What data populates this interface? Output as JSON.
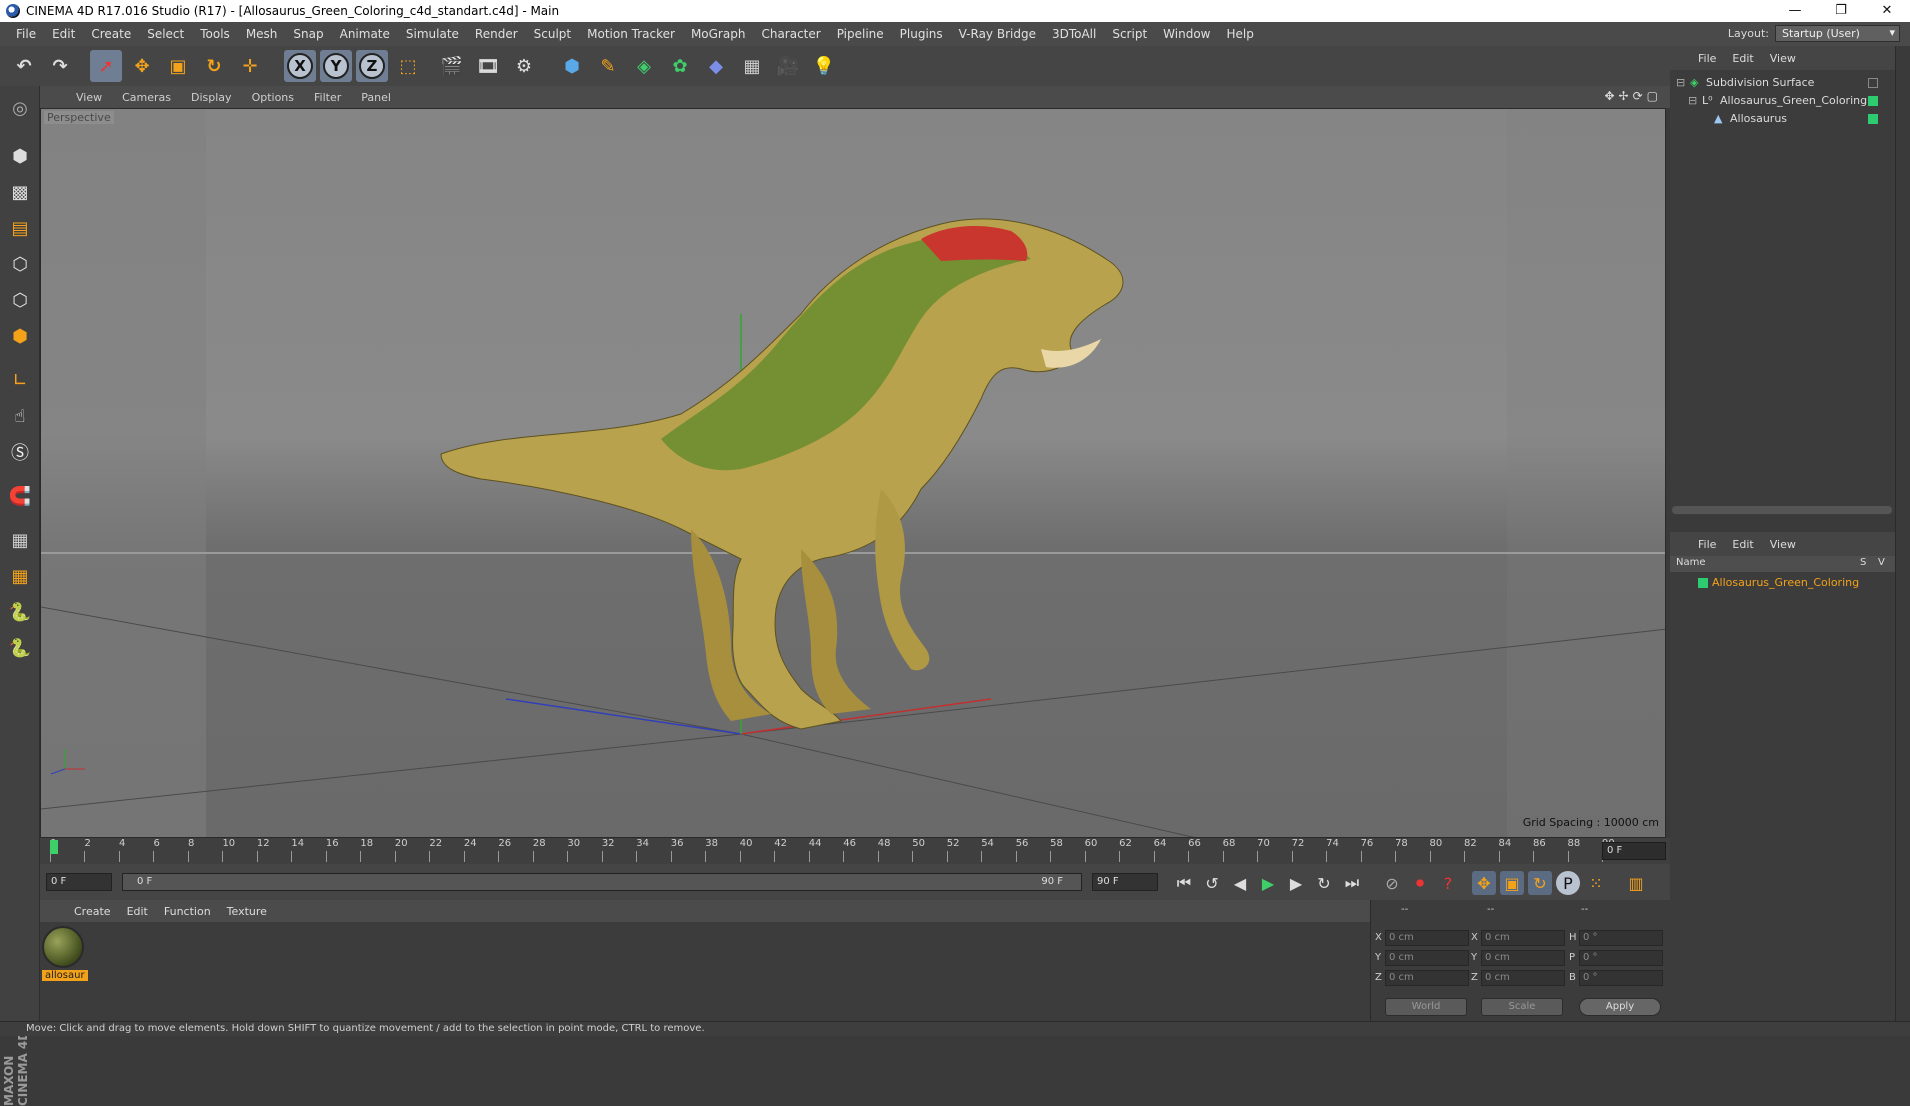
{
  "window": {
    "title": "CINEMA 4D R17.016 Studio (R17) - [Allosaurus_Green_Coloring_c4d_standart.c4d] - Main",
    "controls": [
      "—",
      "❐",
      "✕"
    ]
  },
  "menubar": {
    "items": [
      "File",
      "Edit",
      "Create",
      "Select",
      "Tools",
      "Mesh",
      "Snap",
      "Animate",
      "Simulate",
      "Render",
      "Sculpt",
      "Motion Tracker",
      "MoGraph",
      "Character",
      "Pipeline",
      "Plugins",
      "V-Ray Bridge",
      "3DToAll",
      "Script",
      "Window",
      "Help"
    ],
    "layout_label": "Layout:",
    "layout_value": "Startup (User)"
  },
  "toolbar": {
    "axis_x": "X",
    "axis_y": "Y",
    "axis_z": "Z"
  },
  "viewport": {
    "menu": [
      "View",
      "Cameras",
      "Display",
      "Options",
      "Filter",
      "Panel"
    ],
    "label": "Perspective",
    "grid_spacing": "Grid Spacing : 10000 cm"
  },
  "timeline": {
    "ticks": [
      "0",
      "2",
      "4",
      "6",
      "8",
      "10",
      "12",
      "14",
      "16",
      "18",
      "20",
      "22",
      "24",
      "26",
      "28",
      "30",
      "32",
      "34",
      "36",
      "38",
      "40",
      "42",
      "44",
      "46",
      "48",
      "50",
      "52",
      "54",
      "56",
      "58",
      "60",
      "62",
      "64",
      "66",
      "68",
      "70",
      "72",
      "74",
      "76",
      "78",
      "80",
      "82",
      "84",
      "86",
      "88",
      "90"
    ],
    "current_frame": "0 F"
  },
  "transport": {
    "start": "0 F",
    "range_start": "0 F",
    "range_end": "90 F",
    "end": "90 F"
  },
  "material_manager": {
    "menu": [
      "Create",
      "Edit",
      "Function",
      "Texture"
    ],
    "material_name": "allosaur"
  },
  "coordinates": {
    "header": [
      "--",
      "--",
      "--"
    ],
    "rows": [
      {
        "axis": "X",
        "pos": "0 cm",
        "axis2": "X",
        "size": "0 cm",
        "rot_label": "H",
        "rot": "0 °"
      },
      {
        "axis": "Y",
        "pos": "0 cm",
        "axis2": "Y",
        "size": "0 cm",
        "rot_label": "P",
        "rot": "0 °"
      },
      {
        "axis": "Z",
        "pos": "0 cm",
        "axis2": "Z",
        "size": "0 cm",
        "rot_label": "B",
        "rot": "0 °"
      }
    ],
    "mode1": "World",
    "mode2": "Scale",
    "apply": "Apply"
  },
  "object_manager": {
    "menu": [
      "File",
      "Edit",
      "View"
    ],
    "objects": [
      {
        "name": "Subdivision Surface",
        "color": "#2ecc71"
      },
      {
        "name": "Allosaurus_Green_Coloring",
        "color": "#2ecc71"
      },
      {
        "name": "Allosaurus",
        "color": "#2ecc71"
      }
    ]
  },
  "attribute_manager": {
    "menu": [
      "File",
      "Edit",
      "View"
    ],
    "col_name": "Name",
    "col_s": "S",
    "col_v": "V",
    "layer": "Allosaurus_Green_Coloring",
    "layer_color": "#f2a21a"
  },
  "status": {
    "text": "Move: Click and drag to move elements. Hold down SHIFT to quantize movement / add to the selection in point mode, CTRL to remove."
  },
  "brand": {
    "text": "MAXON CINEMA 4D"
  },
  "colors": {
    "accent": "#6f7e93",
    "highlight": "#f2a21a"
  }
}
